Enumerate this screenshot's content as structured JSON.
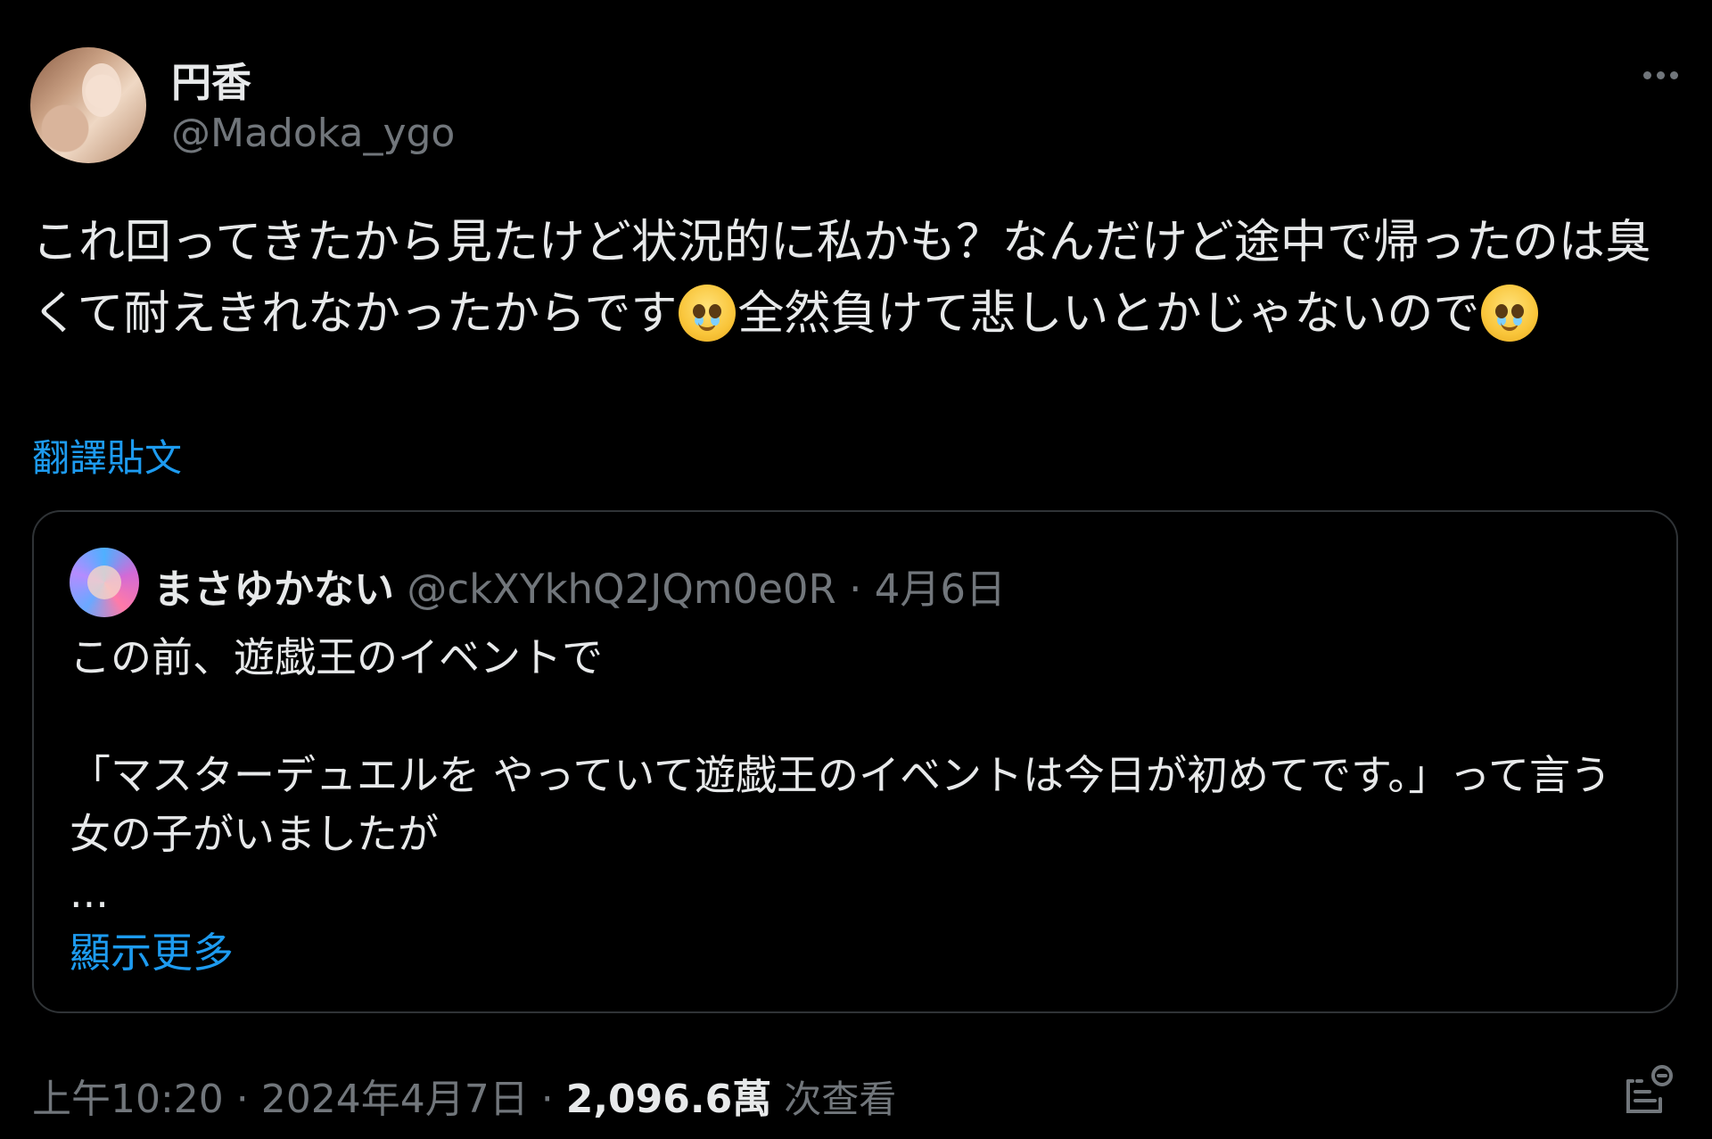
{
  "author": {
    "display_name": "円香",
    "handle": "@Madoka_ygo"
  },
  "icons": {
    "more": "more-horizontal-icon",
    "emoji": "face-holding-back-tears-emoji",
    "analytics": "analytics-icon"
  },
  "post": {
    "text_part1": "これ回ってきたから見たけど状況的に私かも？なんだけど途中で帰ったのは臭くて耐えきれなかったからです",
    "text_part2": "全然負けて悲しいとかじゃないので",
    "translate_label": "翻譯貼文"
  },
  "quoted": {
    "display_name": "まさゆかない",
    "handle": "@ckXYkhQ2JQm0e0R",
    "separator": " · ",
    "date": "4月6日",
    "line1": "この前、遊戯王のイベントで",
    "line2": "「マスターデュエルを やっていて遊戯王のイベントは今日が初めてです。」って言う女の子がいましたが",
    "ellipsis": "...",
    "show_more": "顯示更多"
  },
  "footer": {
    "time": "上午10:20",
    "dot": " · ",
    "date": "2024年4月7日",
    "views_count": "2,096.6萬",
    "views_label": "次查看"
  },
  "colors": {
    "background": "#000000",
    "text": "#e7e9ea",
    "secondary": "#71767b",
    "link": "#1d9bf0",
    "border": "#2f3336"
  }
}
